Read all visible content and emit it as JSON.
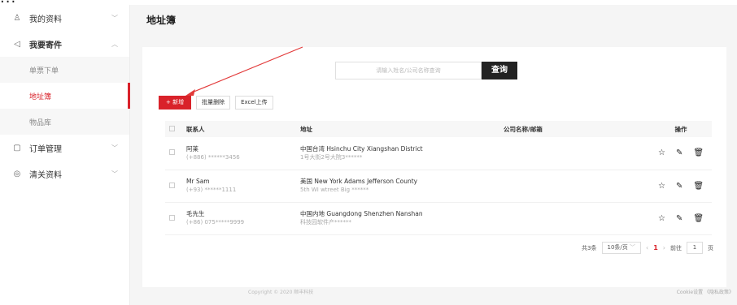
{
  "banner": "...",
  "sidebar": {
    "groups": [
      {
        "icon": "user-icon",
        "glyph": "♙",
        "label": "我的资料",
        "chevron": "﹀"
      },
      {
        "icon": "send-icon",
        "glyph": "◁",
        "label": "我要寄件",
        "chevron": "︿"
      }
    ],
    "subs": [
      {
        "label": "单票下单"
      },
      {
        "label": "地址簿"
      },
      {
        "label": "物品库"
      }
    ],
    "groups2": [
      {
        "icon": "order-icon",
        "glyph": "▢",
        "label": "订单管理",
        "chevron": "﹀"
      },
      {
        "icon": "customs-icon",
        "glyph": "◎",
        "label": "清关资料",
        "chevron": "﹀"
      }
    ]
  },
  "page": {
    "title": "地址簿"
  },
  "search": {
    "placeholder": "请输入姓名/公司名称查询",
    "button": "查询"
  },
  "toolbar": {
    "add": "+ 新增",
    "batch_delete": "批量删除",
    "excel_upload": "Excel上传"
  },
  "table": {
    "headers": {
      "contact": "联系人",
      "address": "地址",
      "company": "公司名称/邮箱",
      "actions": "操作"
    },
    "rows": [
      {
        "name": "阿莱",
        "phone": "(+886) ******3456",
        "addr1": "中国台湾 Hsinchu City Xiangshan District",
        "addr2": "1号大街2号大院3******",
        "company": ""
      },
      {
        "name": "Mr Sam",
        "phone": "(+93) ******1111",
        "addr1": "美国 New York Adams Jefferson County",
        "addr2": "5th WI wtreet Big ******",
        "company": ""
      },
      {
        "name": "毛先生",
        "phone": "(+86) 075*****9999",
        "addr1": "中国内地 Guangdong Shenzhen Nanshan",
        "addr2": "科技园软件产******",
        "company": ""
      }
    ]
  },
  "icons": {
    "star": "☆",
    "edit": "✎",
    "delete": "🗑"
  },
  "pagination": {
    "total": "共3条",
    "page_size": "10条/页",
    "current": "1",
    "goto_label": "前往",
    "goto_value": "1",
    "page_unit": "页",
    "prev": "‹",
    "next": "›"
  },
  "footer": {
    "copyright": "Copyright © 2020 顺丰科技",
    "links": "Cookie设置  《隐私政策》"
  },
  "colors": {
    "accent": "#d9222a",
    "dark_button": "#222222"
  }
}
